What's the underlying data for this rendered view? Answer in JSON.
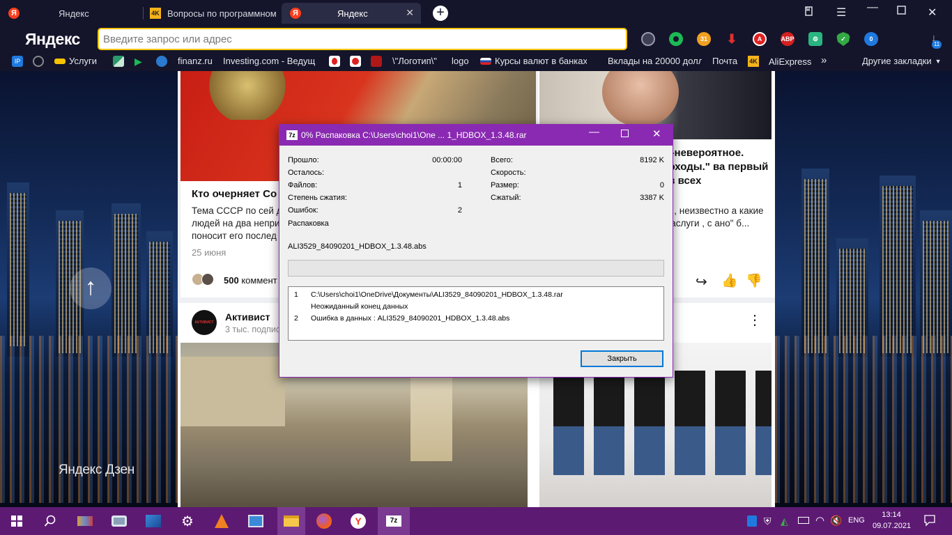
{
  "browser": {
    "tabs": [
      {
        "label": "Яндекс"
      },
      {
        "label": "Вопросы по программном"
      },
      {
        "label": "Яндекс"
      }
    ],
    "logo": "Яндекс",
    "address_placeholder": "Введите запрос или адрес",
    "extension_badges": {
      "calendar": "31",
      "dropbox": "0",
      "downloads": "11",
      "abp": "ABP"
    },
    "bookmarks": [
      {
        "label": "Услуги"
      },
      {
        "label": "finanz.ru"
      },
      {
        "label": "Investing.com - Ведущ"
      },
      {
        "label": "\\\"Логотип\\\""
      },
      {
        "label": "logo"
      },
      {
        "label": "Курсы валют в банках"
      },
      {
        "label": "Вклады на 20000 долл"
      },
      {
        "label": "Почта"
      },
      {
        "label": "AliExpress"
      }
    ],
    "bookmarks_more": "»",
    "other_bookmarks": "Другие закладки"
  },
  "zen": {
    "logo": "Яндекс Дзен",
    "card1": {
      "title": "Кто очерняет Со",
      "text": "Тема СССР по сей д людей на два непри поносит его послед",
      "date": "25 июня",
      "comments": "500",
      "comments_label": "коммент"
    },
    "card2": {
      "title": "е -невероятное. доходы.\" ва первый ив всех",
      "text": "а , неизвестно а какие заслуги , с ано\" б..."
    },
    "card3": {
      "channel": "Активист",
      "subs": "3 тыс. подпис",
      "logo_text": "АКТИВИСТ"
    }
  },
  "dialog": {
    "icon": "7z",
    "title": "0% Распаковка C:\\Users\\choi1\\One ... 1_HDBOX_1.3.48.rar",
    "left": [
      {
        "label": "Прошло:",
        "value": "00:00:00"
      },
      {
        "label": "Осталось:",
        "value": ""
      },
      {
        "label": "Файлов:",
        "value": "1"
      },
      {
        "label": "Степень сжатия:",
        "value": ""
      },
      {
        "label": "Ошибок:",
        "value": "2"
      },
      {
        "label": "Распаковка",
        "value": ""
      }
    ],
    "right": [
      {
        "label": "Всего:",
        "value": "8192 K"
      },
      {
        "label": "Скорость:",
        "value": ""
      },
      {
        "label": "Размер:",
        "value": "0"
      },
      {
        "label": "Сжатый:",
        "value": "3387 K"
      }
    ],
    "current_file": "ALI3529_84090201_HDBOX_1.3.48.abs",
    "progress": 0,
    "messages": [
      {
        "num": "1",
        "text": "C:\\Users\\choi1\\OneDrive\\Документы\\ALI3529_84090201_HDBOX_1.3.48.rar"
      },
      {
        "num": "",
        "text": "Неожиданный конец данных"
      },
      {
        "num": "2",
        "text": "Ошибка в данных : ALI3529_84090201_HDBOX_1.3.48.abs"
      }
    ],
    "close_button": "Закрыть"
  },
  "taskbar": {
    "lang": "ENG",
    "time": "13:14",
    "date": "09.07.2021",
    "active_app_label": "7z"
  },
  "colors": {
    "accent": "#8a2ab2",
    "taskbar": "#5d1a73",
    "browser_chrome": "#14152a",
    "yandex_red": "#fc3f1d",
    "address_border": "#f6c400"
  }
}
